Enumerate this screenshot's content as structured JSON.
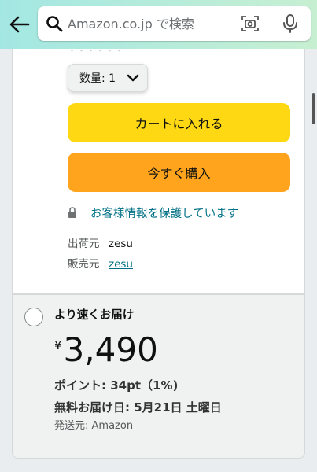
{
  "header": {
    "search_placeholder": "Amazon.co.jp で検索"
  },
  "purchase": {
    "quantity_label": "数量: 1",
    "add_to_cart": "カートに入れる",
    "buy_now": "今すぐ購入",
    "secure_text": "お客様情報を保護しています",
    "ships_from_label": "出荷元",
    "ships_from_value": "zesu",
    "sold_by_label": "販売元",
    "sold_by_value": "zesu"
  },
  "option": {
    "title": "より速くお届け",
    "currency": "¥",
    "price": "3,490",
    "points": "ポイント: 34pt（1%)",
    "delivery": "無料お届け日: 5月21日 土曜日",
    "ships_from": "発送元: Amazon"
  },
  "colors": {
    "cart_button": "#ffd814",
    "buy_button": "#ffa41c",
    "link": "#007185"
  }
}
